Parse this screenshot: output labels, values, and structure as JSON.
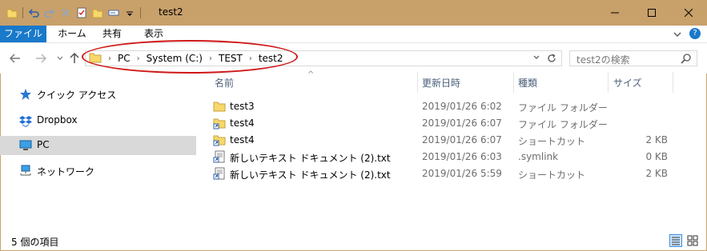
{
  "window": {
    "title": "test2"
  },
  "ribbon": {
    "tabs": [
      "ファイル",
      "ホーム",
      "共有",
      "表示"
    ],
    "help_label": "?"
  },
  "navigation": {
    "breadcrumbs": [
      "PC",
      "System (C:)",
      "TEST",
      "test2"
    ],
    "search_placeholder": "test2の検索"
  },
  "sidebar": {
    "items": [
      {
        "label": "クイック アクセス",
        "icon": "star-icon"
      },
      {
        "label": "Dropbox",
        "icon": "dropbox-icon"
      },
      {
        "label": "PC",
        "icon": "pc-icon",
        "selected": true
      },
      {
        "label": "ネットワーク",
        "icon": "network-icon"
      }
    ]
  },
  "columns": [
    "名前",
    "更新日時",
    "種類",
    "サイズ"
  ],
  "files": [
    {
      "name": "test3",
      "modified": "2019/01/26 6:02",
      "type": "ファイル フォルダー",
      "size": "",
      "icon": "folder-icon"
    },
    {
      "name": "test4",
      "modified": "2019/01/26 6:07",
      "type": "ファイル フォルダー",
      "size": "",
      "icon": "folder-shortcut-icon"
    },
    {
      "name": "test4",
      "modified": "2019/01/26 6:07",
      "type": "ショートカット",
      "size": "2 KB",
      "icon": "folder-shortcut-icon"
    },
    {
      "name": "新しいテキスト ドキュメント (2).txt",
      "modified": "2019/01/26 6:03",
      "type": ".symlink",
      "size": "0 KB",
      "icon": "text-shortcut-icon"
    },
    {
      "name": "新しいテキスト ドキュメント (2).txt",
      "modified": "2019/01/26 5:59",
      "type": "ショートカット",
      "size": "2 KB",
      "icon": "text-shortcut-icon"
    }
  ],
  "status": {
    "item_count": "5 個の項目"
  },
  "colors": {
    "titlebar": "#c8a06a",
    "accent": "#1979ca",
    "highlight_ellipse": "#d01818",
    "selected_bg": "#d9d9d9"
  }
}
